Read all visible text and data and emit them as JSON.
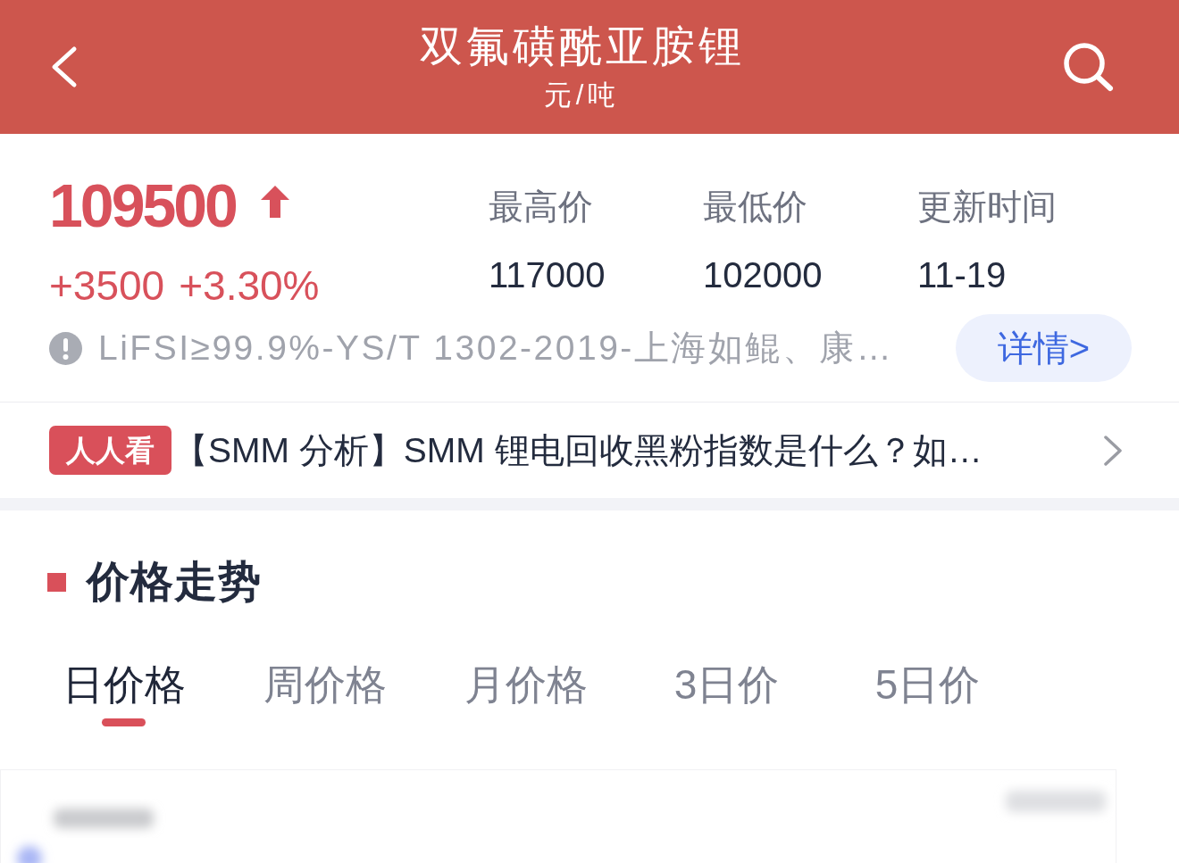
{
  "header": {
    "title": "双氟磺酰亚胺锂",
    "subtitle": "元/吨"
  },
  "quote": {
    "price": "109500",
    "rising": true,
    "change": "+3500",
    "change_percent": "+3.30%",
    "stats": [
      {
        "label": "最高价",
        "value": "117000"
      },
      {
        "label": "最低价",
        "value": "102000"
      },
      {
        "label": "更新时间",
        "value": "11-19"
      }
    ],
    "spec": "LiFSI≥99.9%-YS/T 1302-2019-上海如鲲、康…",
    "details_button": "详情>"
  },
  "news": {
    "badge": "人人看",
    "headline": "【SMM 分析】SMM 锂电回收黑粉指数是什么？如…"
  },
  "price_trend": {
    "title": "价格走势",
    "tabs": [
      {
        "label": "日价格",
        "selected": true
      },
      {
        "label": "周价格",
        "selected": false
      },
      {
        "label": "月价格",
        "selected": false
      },
      {
        "label": "3日价",
        "selected": false
      },
      {
        "label": "5日价",
        "selected": false
      }
    ]
  }
}
